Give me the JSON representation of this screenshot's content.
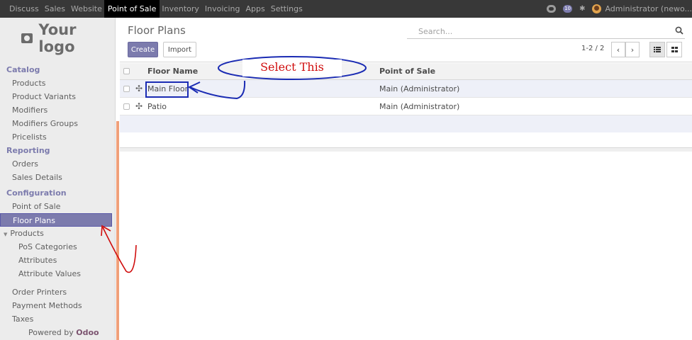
{
  "topbar": {
    "menu": [
      "Discuss",
      "Sales",
      "Website",
      "Point of Sale",
      "Inventory",
      "Invoicing",
      "Apps",
      "Settings"
    ],
    "active": "Point of Sale",
    "badge_count": "10",
    "user": "Administrator (newo..."
  },
  "sidebar": {
    "logo_text": "Your logo",
    "sections": {
      "catalog": "Catalog",
      "reporting": "Reporting",
      "configuration": "Configuration"
    },
    "catalog_items": [
      "Products",
      "Product Variants",
      "Modifiers",
      "Modifiers Groups",
      "Pricelists"
    ],
    "reporting_items": [
      "Orders",
      "Sales Details"
    ],
    "config_items": [
      "Point of Sale",
      "Floor Plans"
    ],
    "products_folder": "Products",
    "products_sub": [
      "PoS Categories",
      "Attributes",
      "Attribute Values"
    ],
    "more_items": [
      "Order Printers",
      "Payment Methods",
      "Taxes"
    ],
    "powered_prefix": "Powered by",
    "powered_brand": "Odoo"
  },
  "control": {
    "title": "Floor Plans",
    "create": "Create",
    "import": "Import",
    "search_placeholder": "Search...",
    "pager": "1-2 / 2"
  },
  "list": {
    "headers": {
      "name": "Floor Name",
      "pos": "Point of Sale"
    },
    "rows": [
      {
        "name": "Main Floor",
        "pos": "Main (Administrator)"
      },
      {
        "name": "Patio",
        "pos": "Main (Administrator)"
      }
    ]
  },
  "annotation": {
    "label": "Select This",
    "color": "#d00d0d"
  }
}
